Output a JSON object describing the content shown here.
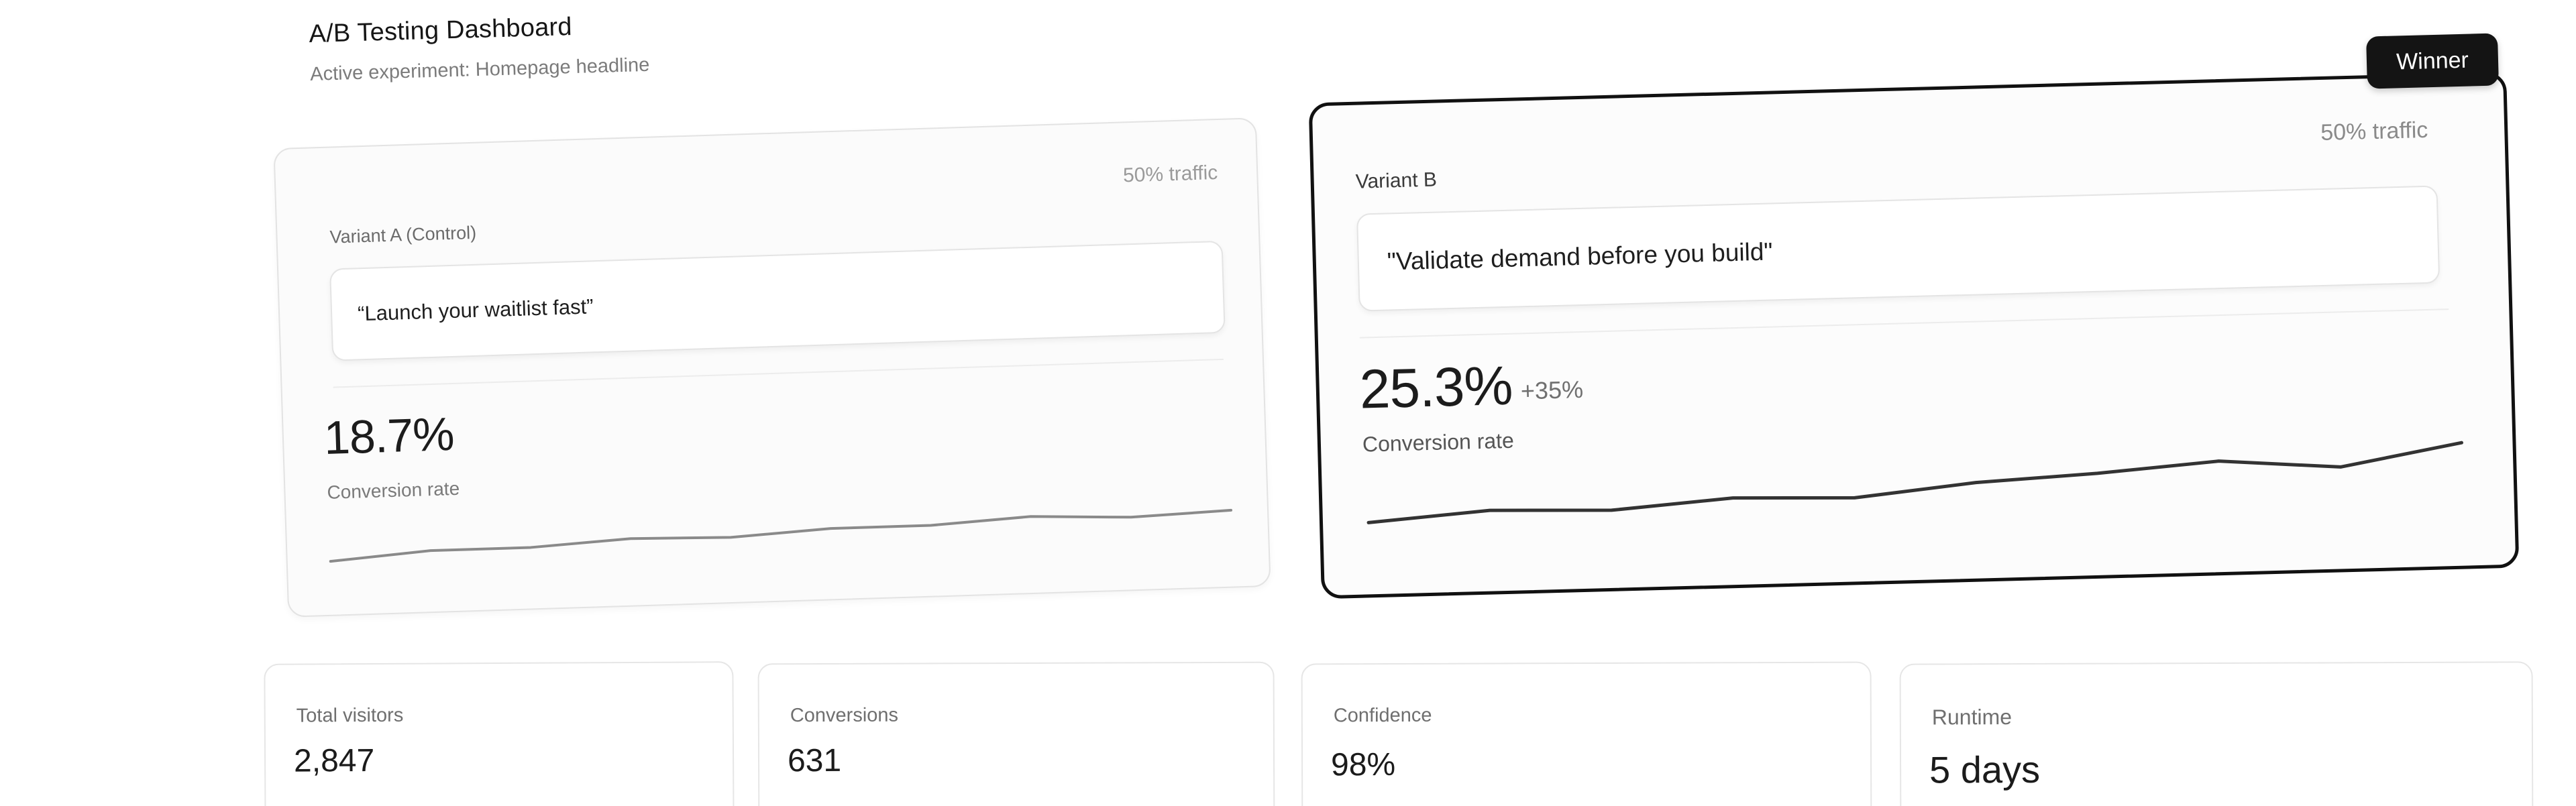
{
  "header": {
    "title": "A/B Testing Dashboard",
    "subtitle": "Active experiment: Homepage headline"
  },
  "variants": [
    {
      "label": "Variant A (Control)",
      "traffic": "50% traffic",
      "headline": "“Launch your waitlist fast”",
      "rate": "18.7%",
      "rate_label": "Conversion rate",
      "trend": [
        10,
        14,
        14,
        17,
        16,
        19,
        19,
        22,
        20,
        22
      ],
      "line_color": "#8a8a8a"
    },
    {
      "label": "Variant B",
      "traffic": "50% traffic",
      "headline": "\"Validate demand before you build\"",
      "rate": "25.3%",
      "lift": "+35%",
      "rate_label": "Conversion rate",
      "trend": [
        14,
        17,
        16,
        19,
        18,
        22,
        24,
        27,
        24,
        31
      ],
      "line_color": "#333333",
      "badge": "Winner"
    }
  ],
  "stats": [
    {
      "label": "Total visitors",
      "value": "2,847"
    },
    {
      "label": "Conversions",
      "value": "631"
    },
    {
      "label": "Confidence",
      "value": "98%"
    },
    {
      "label": "Runtime",
      "value": "5 days"
    }
  ]
}
